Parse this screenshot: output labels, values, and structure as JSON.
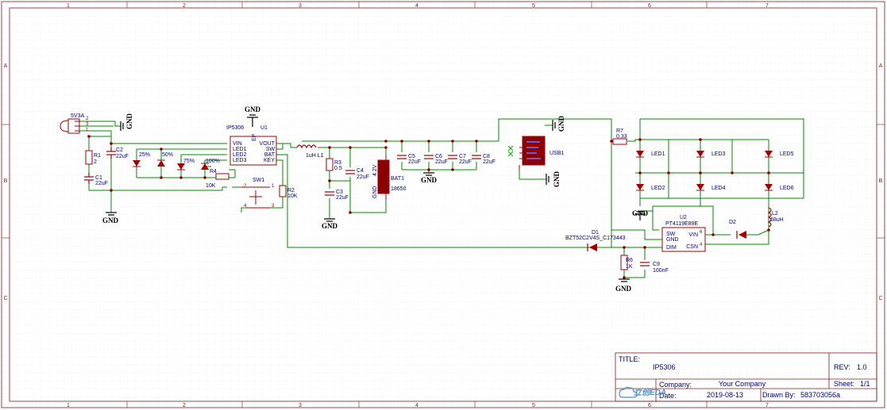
{
  "colors": {
    "wire": "#008800",
    "component": "#a00000",
    "label": "#00007f",
    "border": "#8b1a1a",
    "grid": "#e6e6e6",
    "chip_body": "#8b0000",
    "chip_text": "#6a5acd"
  },
  "frame": {
    "columns": [
      "1",
      "2",
      "3",
      "4",
      "5",
      "6",
      "7"
    ],
    "rows": [
      "A",
      "B",
      "C"
    ]
  },
  "title_block": {
    "title_label": "TITLE:",
    "title": "IP5306",
    "rev_label": "REV:",
    "rev": "1.0",
    "company_label": "Company:",
    "company": "Your Company",
    "sheet_label": "Sheet:",
    "sheet": "1/1",
    "date_label": "Date:",
    "date": "2019-08-13",
    "drawn_label": "Drawn By:",
    "drawn_by": "583703056a",
    "logo": "立创EDA"
  },
  "components": {
    "usb_in": {
      "name": "5V3A",
      "pins": [
        "2",
        "3",
        "1"
      ]
    },
    "r1": {
      "ref": "R1",
      "value": "2"
    },
    "c2": {
      "ref": "C2",
      "value": "22uF"
    },
    "c1": {
      "ref": "C1",
      "value": "22uF"
    },
    "led_levels": [
      "25%",
      "50%",
      "75%",
      "100%"
    ],
    "r4": {
      "ref": "R4",
      "value": "10K"
    },
    "u1": {
      "value": "IP5306",
      "ref": "U1",
      "left_pins": [
        "VIN",
        "LED1",
        "LED2",
        "LED3"
      ],
      "right_pins": [
        "VOUT",
        "SW",
        "BAT",
        "KEY"
      ],
      "ep": "EP"
    },
    "sw1": {
      "ref": "SW1",
      "pins": [
        "1",
        "2",
        "4",
        "3"
      ]
    },
    "r2": {
      "ref": "R2",
      "value": "10K"
    },
    "l1": {
      "label": "1uH L1"
    },
    "r3": {
      "ref": "R3",
      "value": "0.5"
    },
    "c3": {
      "ref": "C3",
      "value": "22uF"
    },
    "c4": {
      "ref": "C4",
      "value": "22uF"
    },
    "bat1": {
      "ref": "BAT1",
      "value": "18650",
      "voltage": "4.2V",
      "gnd": "GND"
    },
    "c5": {
      "ref": "C5",
      "value": "22uF"
    },
    "c6": {
      "ref": "C6",
      "value": "22uF"
    },
    "c7": {
      "ref": "C7",
      "value": "22uF"
    },
    "c8": {
      "ref": "C8",
      "value": "22uF"
    },
    "usb1": {
      "ref": "USB1"
    },
    "r7": {
      "ref": "R7",
      "value": "0.33"
    },
    "leds": [
      "LED1",
      "LED3",
      "LED5",
      "LED2",
      "LED4",
      "LED6"
    ],
    "l2": {
      "ref": "L2",
      "value": "68uH"
    },
    "d2": {
      "ref": "D2"
    },
    "u2": {
      "value": "PT4119E89E",
      "ref": "U2",
      "left_pins": [
        "SW",
        "GND",
        "DIM"
      ],
      "right_pins": [
        "VIN",
        "CSN"
      ],
      "pin_numbers": [
        "6",
        "4"
      ]
    },
    "d1": {
      "ref": "D1",
      "value": "BZT52C2V4S_C173443"
    },
    "r6": {
      "ref": "R6",
      "value": "1K"
    },
    "c9": {
      "ref": "C9",
      "value": "100nF"
    }
  },
  "ground_label": "GND"
}
